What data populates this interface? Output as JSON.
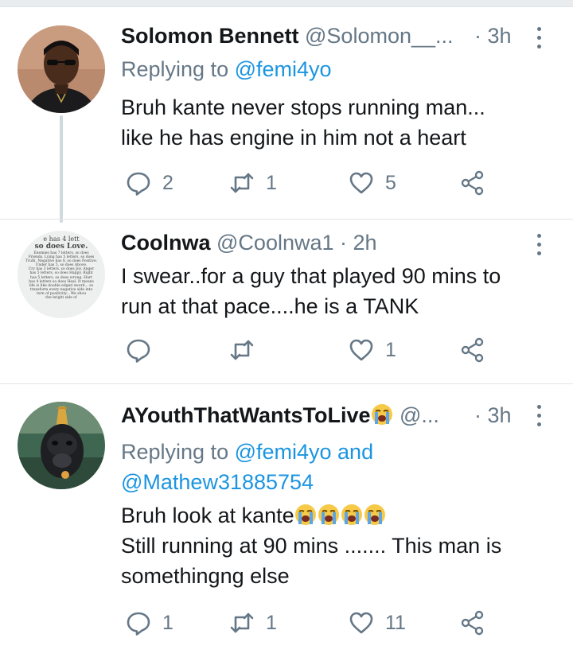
{
  "tweets": [
    {
      "name": "Solomon Bennett",
      "handle": "@Solomon__...",
      "time": "· 3h",
      "replying_prefix": "Replying to ",
      "replying_mentions": "@femi4yo",
      "lines": [
        "Bruh kante never stops running man...",
        "like he has engine in him not a heart"
      ],
      "reply_count": "2",
      "retweet_count": "1",
      "like_count": "5"
    },
    {
      "name": "Coolnwa",
      "handle": "@Coolnwa1",
      "time": "· 2h",
      "lines": [
        "I swear..for a guy that played 90 mins to",
        "run at that pace....he is a TANK"
      ],
      "avatar_text": [
        "e has 4 lett",
        "so does Love.",
        "Enemies has 7 letters, so does",
        "Friends. Lying has 5 letters, so does",
        "Truth. Negative has 8, so does Positive.",
        "Under has 5, so does Above.",
        "Cry has 3 letters, so does Joy. Anger",
        "has 5 letters, so does Happy. Right",
        "has 5 letters, so does wrong. Hurt",
        "has 4 letters so does Heal. It means",
        "life is like double edged sword... so",
        "transform every negative side into",
        "turn of positivity... We shou",
        "the bright side of"
      ],
      "reply_count": "",
      "retweet_count": "",
      "like_count": "1"
    },
    {
      "name": "AYouthThatWantsToLive",
      "handle": "@...",
      "time": "· 3h",
      "replying_prefix": "Replying to ",
      "replying_mentions": "@femi4yo and",
      "replying_mentions_2": "@Mathew31885754",
      "lines": [
        "Bruh look at kante",
        "Still running at 90 mins ....... This man is",
        "somethingng else"
      ],
      "reply_count": "1",
      "retweet_count": "1",
      "like_count": "11"
    }
  ],
  "icons": [
    "reply-icon",
    "retweet-icon",
    "like-icon",
    "share-icon",
    "more-icon",
    "crying-face-emoji"
  ],
  "colors": {
    "link": "#1b95e0",
    "secondary": "#657786",
    "text": "#14171a",
    "thread_line": "#cfd9de"
  }
}
